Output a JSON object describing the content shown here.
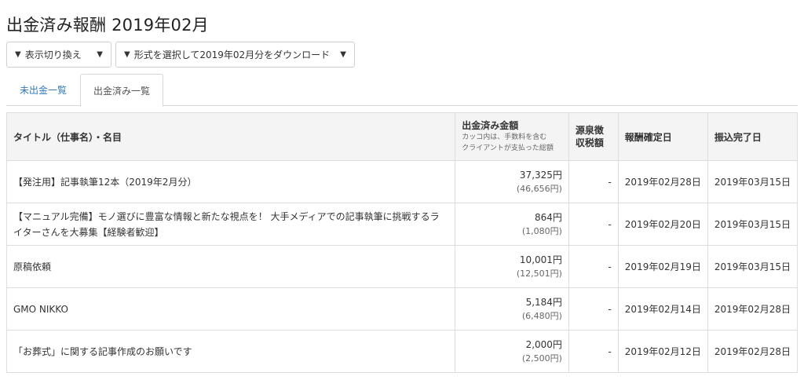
{
  "page": {
    "title": "出金済み報酬 2019年02月"
  },
  "controls": {
    "view_toggle": {
      "arrow": "▼",
      "label": "表示切り換え",
      "caret": "▼"
    },
    "download": {
      "arrow": "▼",
      "label": "形式を選択して2019年02月分をダウンロード",
      "caret": "▼"
    }
  },
  "tabs": [
    {
      "label": "未出金一覧",
      "active": false
    },
    {
      "label": "出金済み一覧",
      "active": true
    }
  ],
  "table": {
    "headers": {
      "title": "タイトル（仕事名）・名目",
      "amount": "出金済み金額",
      "amount_note_1": "カッコ内は、手数料を含む",
      "amount_note_2": "クライアントが支払った総額",
      "tax_1": "源泉徴",
      "tax_2": "収税額",
      "confirmed": "報酬確定日",
      "transferred": "振込完了日"
    },
    "rows": [
      {
        "title": "【発注用】記事執筆12本（2019年2月分）",
        "amount": "37,325円",
        "client_total": "(46,656円)",
        "tax": "-",
        "confirmed": "2019年02月28日",
        "transferred": "2019年03月15日"
      },
      {
        "title": "【マニュアル完備】モノ選びに豊富な情報と新たな視点を！ 大手メディアでの記事執筆に挑戦するライターさんを大募集【経験者歓迎】",
        "amount": "864円",
        "client_total": "(1,080円)",
        "tax": "-",
        "confirmed": "2019年02月20日",
        "transferred": "2019年03月15日"
      },
      {
        "title": "原稿依頼",
        "amount": "10,001円",
        "client_total": "(12,501円)",
        "tax": "-",
        "confirmed": "2019年02月19日",
        "transferred": "2019年03月15日"
      },
      {
        "title": "GMO NIKKO",
        "amount": "5,184円",
        "client_total": "(6,480円)",
        "tax": "-",
        "confirmed": "2019年02月14日",
        "transferred": "2019年02月28日"
      },
      {
        "title": "「お葬式」に関する記事作成のお願いです",
        "amount": "2,000円",
        "client_total": "(2,500円)",
        "tax": "-",
        "confirmed": "2019年02月12日",
        "transferred": "2019年02月28日"
      }
    ]
  }
}
